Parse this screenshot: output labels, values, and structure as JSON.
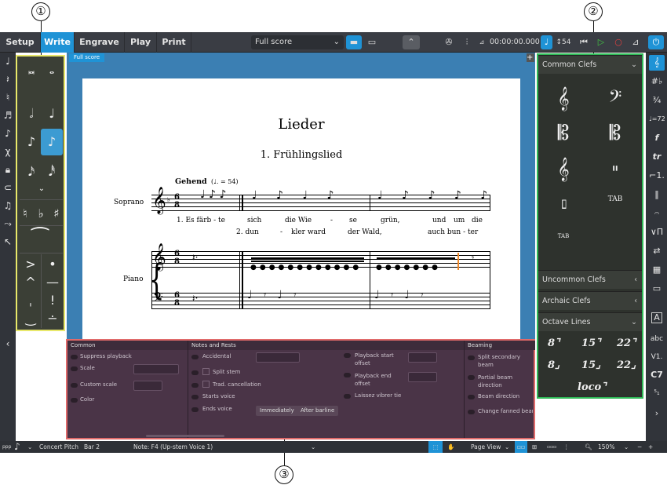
{
  "callouts": {
    "one": "①",
    "two": "②",
    "three": "③"
  },
  "toolbar": {
    "modes": [
      "Setup",
      "Write",
      "Engrave",
      "Play",
      "Print"
    ],
    "active_mode": "Write",
    "layout_select": "Full score",
    "timecode": "00:00:00.000",
    "tempo": "54",
    "icons": [
      "note-input-icon",
      "page-layout-icon",
      "galley-icon",
      "chevron-up-icon",
      "video-icon",
      "mixer-icon",
      "metronome-icon",
      "rewind-icon",
      "play-icon",
      "record-icon",
      "click-icon",
      "power-icon"
    ]
  },
  "left_strip_icons": [
    "note-icon",
    "rest-icon",
    "accidental-icon",
    "tuplet-icon",
    "grace-note-icon",
    "slash-icon",
    "lock-icon",
    "insert-icon",
    "tie-icon",
    "force-duration-icon",
    "select-icon"
  ],
  "notes_panel": {
    "rows": [
      [
        "𝅜",
        "𝅝"
      ],
      [
        "𝅗𝅥",
        "♩"
      ],
      [
        "♪",
        "♪"
      ],
      [
        "𝅘𝅥𝅯",
        "𝅘𝅥𝅰"
      ],
      [
        "⌄",
        ""
      ],
      [
        "♮",
        "♭",
        "♯"
      ],
      [
        "⁀"
      ],
      [
        ">",
        "•"
      ],
      [
        "^",
        "—"
      ],
      [
        "ˌ",
        "!"
      ],
      [
        "‿",
        "∸"
      ]
    ]
  },
  "score": {
    "tab": "Full score",
    "title": "Lieder",
    "subtitle": "1. Frühlingslied",
    "tempo_text": "Gehend",
    "tempo_value": "(♩. = 54)",
    "soprano_label": "Soprano",
    "piano_label": "Piano",
    "time_sig": "6/8",
    "lyrics1": [
      "1. Es färb - te",
      "sich",
      "die Wie",
      "-",
      "se",
      "grün,",
      "und",
      "um",
      "die"
    ],
    "lyrics2": [
      "2. dun",
      "-",
      "kler ward",
      "der Wald,",
      "auch bun - ter"
    ]
  },
  "right_panel": {
    "sections": [
      {
        "title": "Common Clefs",
        "expanded": true
      },
      {
        "title": "Uncommon Clefs",
        "expanded": false
      },
      {
        "title": "Archaic Clefs",
        "expanded": false
      },
      {
        "title": "Octave Lines",
        "expanded": true
      }
    ],
    "clefs": [
      "𝄞",
      "𝄢",
      "𝄡",
      "𝄡",
      "𝄞",
      "𝄥",
      "𝄦",
      "TAB",
      "TAB"
    ],
    "octave_lines": [
      "8⌝",
      "15⌝",
      "22⌝",
      "8⌟",
      "15⌟",
      "22⌟",
      "loco⌝"
    ]
  },
  "right_strip_icons": [
    "clef-icon",
    "key-signature-icon",
    "time-signature-icon",
    "tempo-icon",
    "dynamics-icon",
    "ornaments-icon",
    "repeat-endings-icon",
    "bars-icon",
    "holds-icon",
    "playing-techniques-icon",
    "cue-icon",
    "notations-icon",
    "comments-icon",
    "text-icon",
    "lyrics-icon",
    "figured-bass-icon",
    "chord-symbols-icon",
    "fingering-icon"
  ],
  "properties": {
    "sections": [
      {
        "title": "Common",
        "rows": [
          "Suppress playback",
          "Scale",
          "Custom scale",
          "Color"
        ]
      },
      {
        "title": "Notes and Rests",
        "rows": [
          "Accidental",
          "Split stem",
          "Trad. cancellation",
          "Starts voice",
          "Ends voice"
        ],
        "buttons": [
          "Immediately",
          "After barline"
        ],
        "rows_right": [
          "Playback start offset",
          "Playback end offset",
          "Laissez vibrer tie"
        ]
      },
      {
        "title": "Beaming",
        "rows": [
          "Split secondary beam",
          "Partial beam direction",
          "Beam direction",
          "Change fanned beam di"
        ]
      }
    ]
  },
  "status": {
    "concert_pitch": "Concert Pitch",
    "bar": "Bar 2",
    "note": "Note: F4 (Up-stem Voice 1)",
    "view": "Page View",
    "zoom": "150%"
  }
}
